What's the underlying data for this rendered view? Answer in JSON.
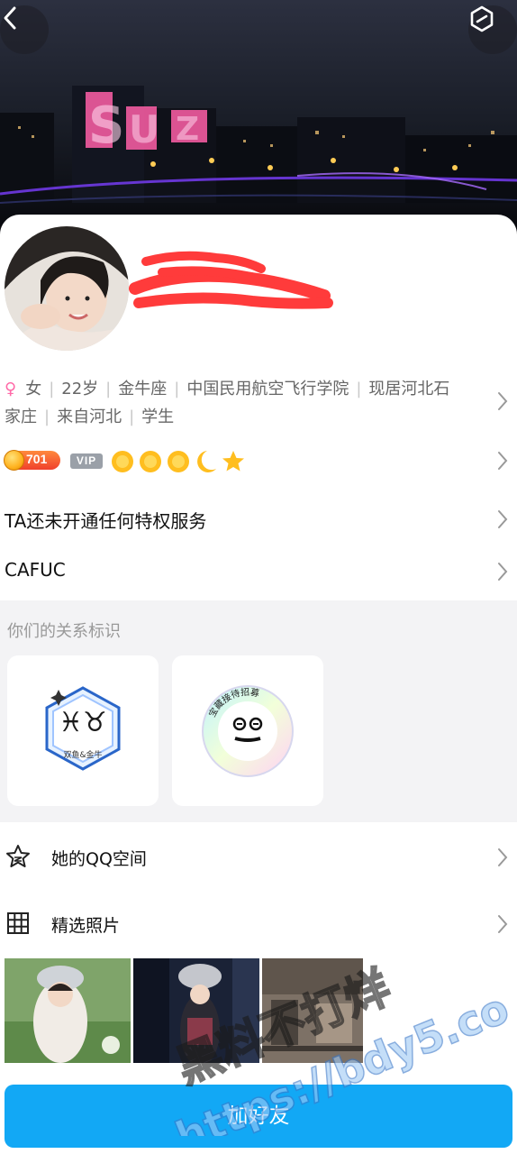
{
  "header": {
    "back_icon": "chevron-left-icon",
    "more_icon": "hexagon-menu-icon"
  },
  "cover": {
    "sign_text": "SUZ"
  },
  "profile": {
    "gender_symbol": "♀",
    "gender": "女",
    "age": "22岁",
    "zodiac": "金牛座",
    "school": "中国民用航空飞行学院",
    "location": "现居河北石家庄",
    "hometown": "来自河北",
    "occupation": "学生"
  },
  "badges": {
    "level": "701",
    "vip_label": "VIP"
  },
  "rows": {
    "privilege": "TA还未开通任何特权服务",
    "signature": "CAFUC"
  },
  "relationship": {
    "title": "你们的关系标识",
    "badge1_label": "双鱼&金牛",
    "badge2_label": "宝藏接待招募"
  },
  "nav": {
    "qzone_label": "她的QQ空间",
    "photos_label": "精选照片"
  },
  "action": {
    "add_friend_label": "加好友"
  },
  "watermark": {
    "line1": "黑料不打烊",
    "line2": "https://bdy5.co"
  },
  "colors": {
    "accent": "#12a8f5",
    "gender_pink": "#ff6aa8",
    "level_orange": "#f0402c"
  }
}
